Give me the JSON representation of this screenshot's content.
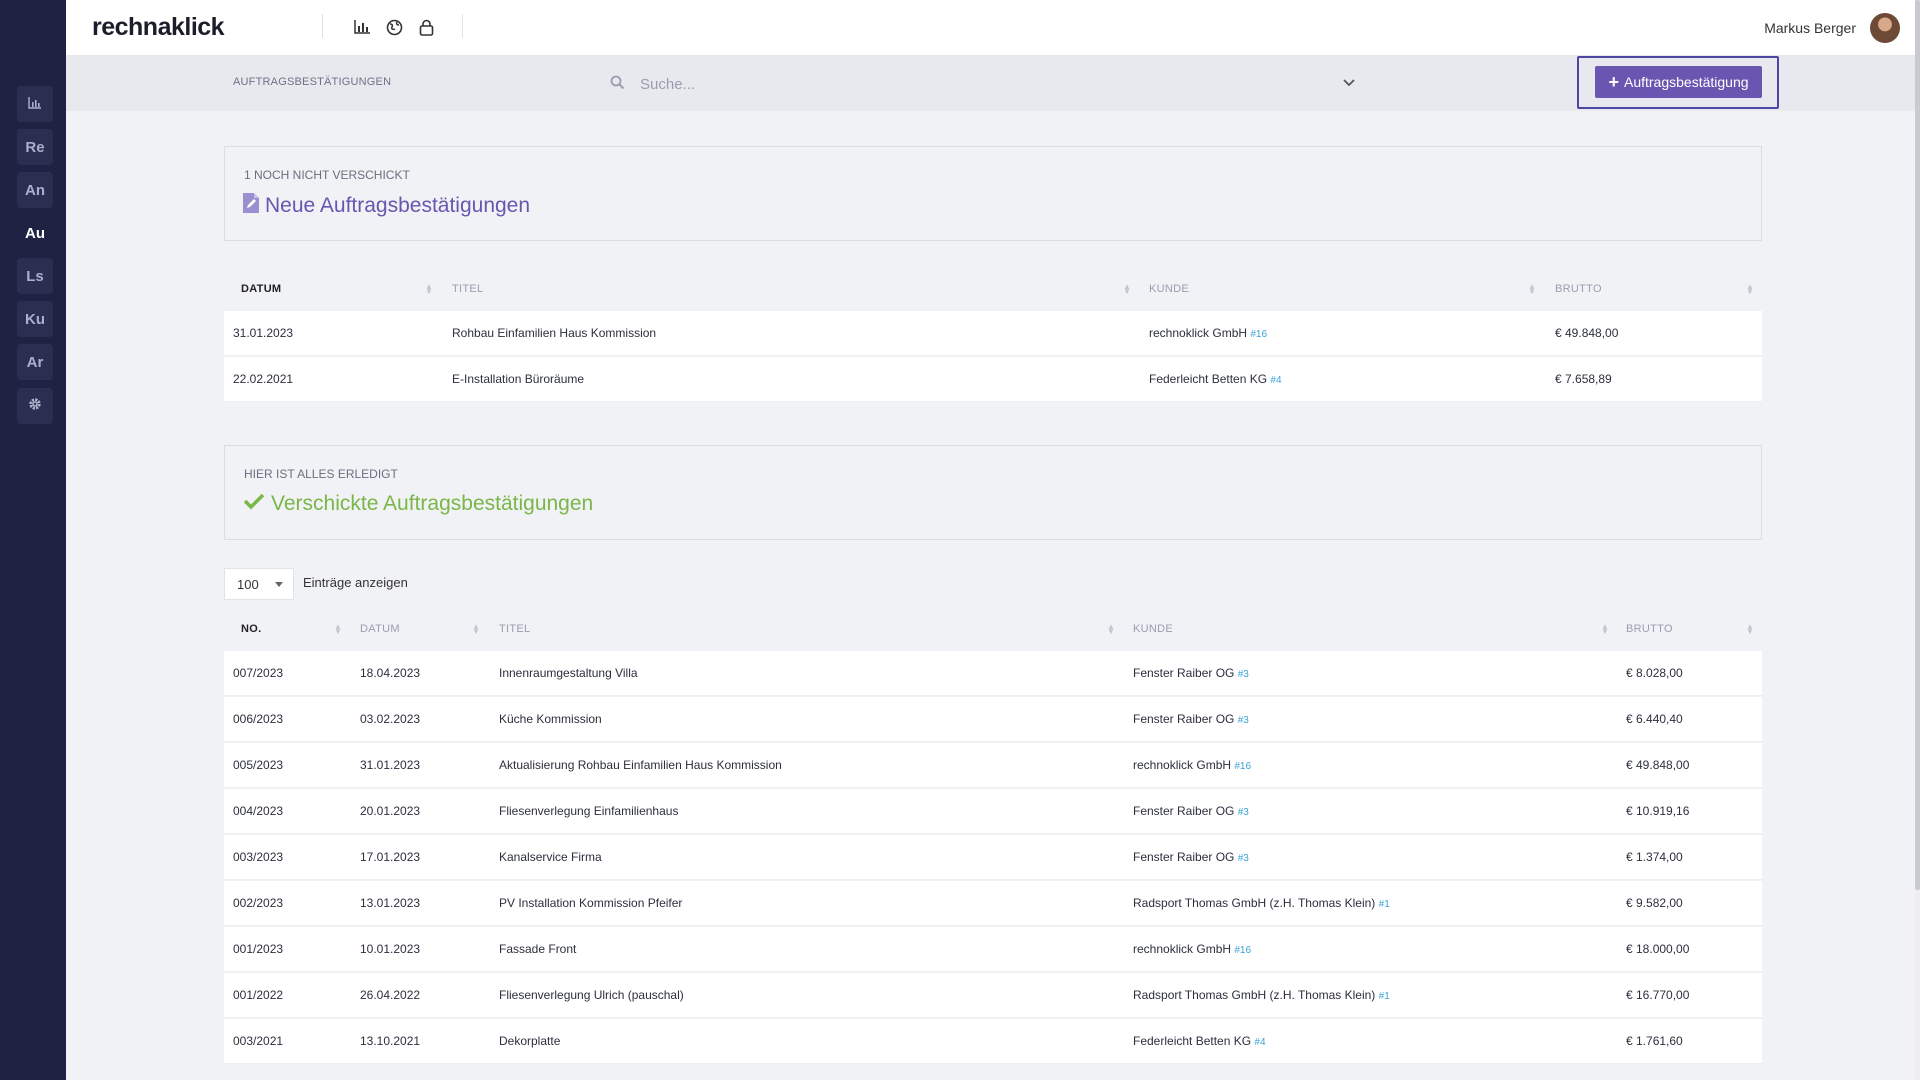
{
  "app": {
    "logo": "rechnaklick"
  },
  "sidebar": {
    "items": [
      {
        "label": "",
        "icon": "chart-icon"
      },
      {
        "label": "Re"
      },
      {
        "label": "An"
      },
      {
        "label": "Au",
        "active": true
      },
      {
        "label": "Ls"
      },
      {
        "label": "Ku"
      },
      {
        "label": "Ar"
      },
      {
        "label": "",
        "icon": "gear-icon"
      }
    ]
  },
  "topbar": {
    "icons": [
      "bar-chart-icon",
      "globe-icon",
      "lock-icon"
    ],
    "user_name": "Markus Berger"
  },
  "subbar": {
    "section_label": "AUFTRAGSBESTÄTIGUNGEN",
    "search_placeholder": "Suche...",
    "new_button_label": "Auftragsbestätigung"
  },
  "new_panel": {
    "subtitle": "1 NOCH NICHT VERSCHICKT",
    "title": "Neue Auftragsbestätigungen",
    "title_color": "#6a55b0"
  },
  "new_table": {
    "headers": [
      "DATUM",
      "TITEL",
      "KUNDE",
      "BRUTTO"
    ],
    "rows": [
      {
        "datum": "31.01.2023",
        "titel": "Rohbau Einfamilien Haus Kommission",
        "kunde": "rechnoklick GmbH",
        "kunde_id": "#16",
        "brutto": "€ 49.848,00"
      },
      {
        "datum": "22.02.2021",
        "titel": "E-Installation Büroräume",
        "kunde": "Federleicht Betten KG",
        "kunde_id": "#4",
        "brutto": "€ 7.658,89"
      }
    ]
  },
  "sent_panel": {
    "subtitle": "HIER IST ALLES ERLEDIGT",
    "title": "Verschickte Auftragsbestätigungen",
    "title_color": "#7ab648"
  },
  "sent_table": {
    "length_value": "100",
    "length_label": "Einträge anzeigen",
    "headers": [
      "NO.",
      "DATUM",
      "TITEL",
      "KUNDE",
      "BRUTTO"
    ],
    "rows": [
      {
        "no": "007/2023",
        "datum": "18.04.2023",
        "titel": "Innenraumgestaltung Villa",
        "kunde": "Fenster Raiber OG",
        "kunde_id": "#3",
        "brutto": "€ 8.028,00"
      },
      {
        "no": "006/2023",
        "datum": "03.02.2023",
        "titel": "Küche Kommission",
        "kunde": "Fenster Raiber OG",
        "kunde_id": "#3",
        "brutto": "€ 6.440,40"
      },
      {
        "no": "005/2023",
        "datum": "31.01.2023",
        "titel": "Aktualisierung Rohbau Einfamilien Haus Kommission",
        "kunde": "rechnoklick GmbH",
        "kunde_id": "#16",
        "brutto": "€ 49.848,00"
      },
      {
        "no": "004/2023",
        "datum": "20.01.2023",
        "titel": "Fliesenverlegung Einfamilienhaus",
        "kunde": "Fenster Raiber OG",
        "kunde_id": "#3",
        "brutto": "€ 10.919,16"
      },
      {
        "no": "003/2023",
        "datum": "17.01.2023",
        "titel": "Kanalservice Firma",
        "kunde": "Fenster Raiber OG",
        "kunde_id": "#3",
        "brutto": "€ 1.374,00"
      },
      {
        "no": "002/2023",
        "datum": "13.01.2023",
        "titel": "PV Installation Kommission Pfeifer",
        "kunde": "Radsport Thomas GmbH (z.H. Thomas Klein)",
        "kunde_id": "#1",
        "brutto": "€ 9.582,00"
      },
      {
        "no": "001/2023",
        "datum": "10.01.2023",
        "titel": "Fassade Front",
        "kunde": "rechnoklick GmbH",
        "kunde_id": "#16",
        "brutto": "€ 18.000,00"
      },
      {
        "no": "001/2022",
        "datum": "26.04.2022",
        "titel": "Fliesenverlegung Ulrich (pauschal)",
        "kunde": "Radsport Thomas GmbH (z.H. Thomas Klein)",
        "kunde_id": "#1",
        "brutto": "€ 16.770,00"
      },
      {
        "no": "003/2021",
        "datum": "13.10.2021",
        "titel": "Dekorplatte",
        "kunde": "Federleicht Betten KG",
        "kunde_id": "#4",
        "brutto": "€ 1.761,60"
      }
    ]
  }
}
